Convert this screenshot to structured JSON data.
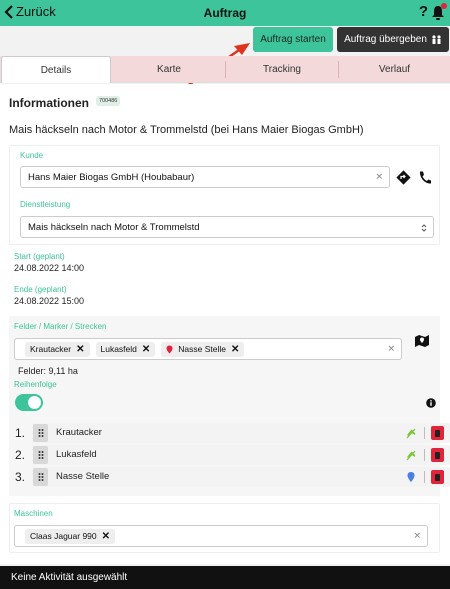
{
  "topbar": {
    "back_label": "Zurück",
    "title": "Auftrag",
    "help": "?"
  },
  "actions": {
    "start_label": "Auftrag starten",
    "handover_label": "Auftrag übergeben"
  },
  "tabs": [
    {
      "label": "Details",
      "active": true
    },
    {
      "label": "Karte"
    },
    {
      "label": "Tracking"
    },
    {
      "label": "Verlauf"
    }
  ],
  "info": {
    "heading": "Informationen",
    "order_number": "700486",
    "job_title": "Mais häckseln nach Motor & Trommelstd (bei Hans Maier Biogas GmbH)"
  },
  "customer": {
    "label": "Kunde",
    "value": "Hans Maier Biogas GmbH (Houbabaur)"
  },
  "service": {
    "label": "Dienstleistung",
    "value": "Mais häckseln nach Motor & Trommelstd"
  },
  "start": {
    "label": "Start (geplant)",
    "value": "24.08.2022 14:00"
  },
  "end": {
    "label": "Ende (geplant)",
    "value": "24.08.2022 15:00"
  },
  "fields": {
    "label": "Felder / Marker / Strecken",
    "chips": [
      "Krautacker",
      "Lukasfeld",
      "Nasse Stelle"
    ],
    "area": "Felder: 9,11 ha",
    "order_label": "Reihenfolge",
    "sequence": [
      {
        "num": "1.",
        "name": "Krautacker",
        "icon": "wheat-icon"
      },
      {
        "num": "2.",
        "name": "Lukasfeld",
        "icon": "wheat-icon"
      },
      {
        "num": "3.",
        "name": "Nasse Stelle",
        "icon": "map-pin-icon"
      }
    ]
  },
  "machines": {
    "label": "Maschinen",
    "chips": [
      "Claas Jaguar 990"
    ]
  },
  "status": {
    "text": "Keine Aktivität ausgewählt"
  },
  "colors": {
    "accent": "#3dc49a",
    "danger": "#e0243c",
    "dark": "#111111"
  }
}
